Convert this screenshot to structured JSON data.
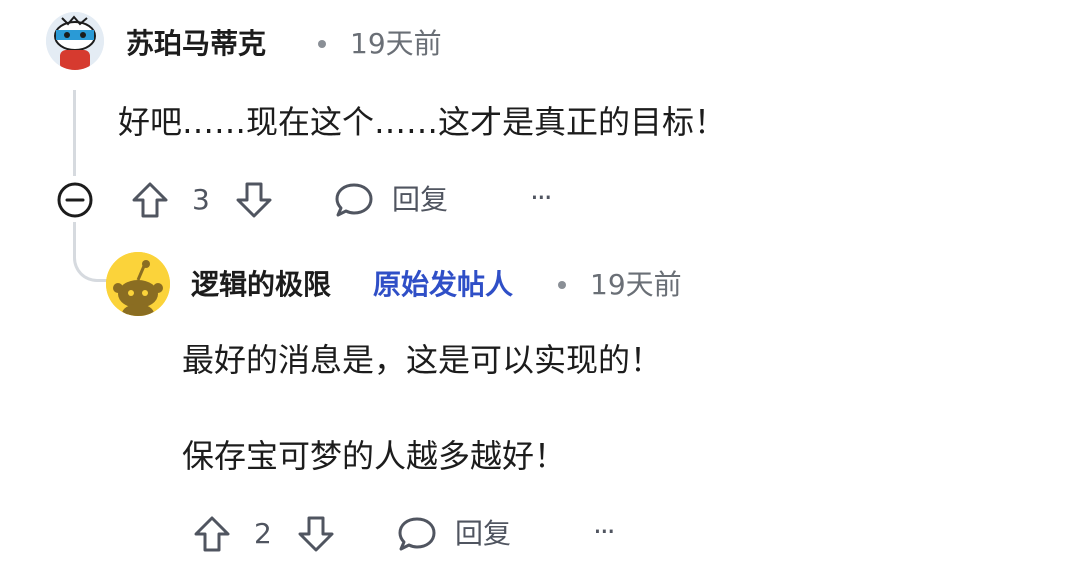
{
  "comments": [
    {
      "username": "苏珀马蒂克",
      "time": "19天前",
      "body": [
        "好吧……现在这个……这才是真正的目标！"
      ],
      "votes": "3",
      "reply_label": "回复",
      "more_label": "···"
    },
    {
      "username": "逻辑的极限",
      "op_badge": "原始发帖人",
      "time": "19天前",
      "body": [
        "最好的消息是，这是可以实现的！",
        "保存宝可梦的人越多越好！"
      ],
      "votes": "2",
      "reply_label": "回复",
      "more_label": "···"
    }
  ],
  "colors": {
    "op_badge": "#2f4fc7",
    "avatar2_bg": "#fbd33a",
    "thread_line": "#d6dadf"
  },
  "icons": {
    "upvote": "arrow-up-outline",
    "downvote": "arrow-down-outline",
    "reply": "speech-bubble",
    "collapse": "minus-circle",
    "more": "ellipsis"
  }
}
